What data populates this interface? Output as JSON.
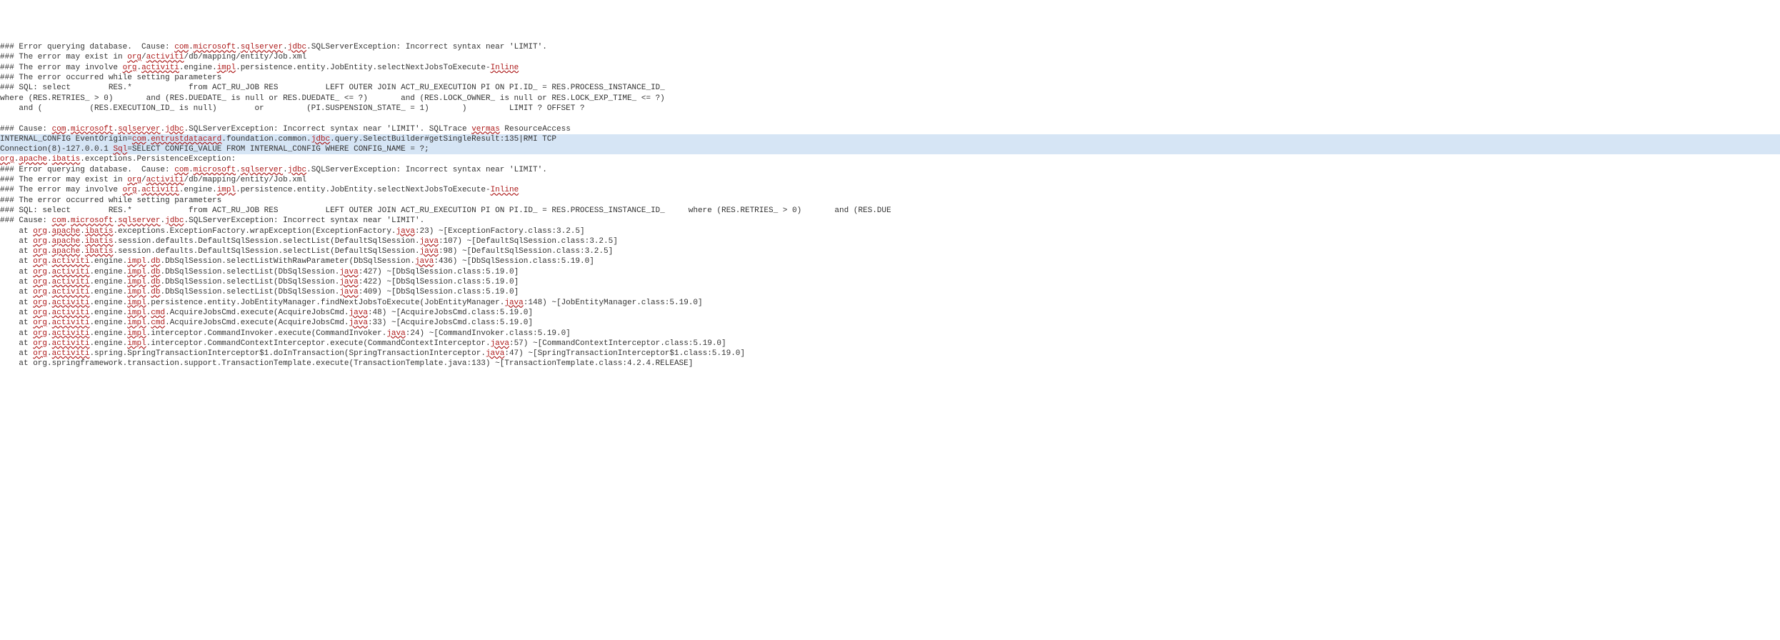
{
  "log": {
    "lines": [
      {
        "cls": "",
        "parts": [
          {
            "t": "### Error querying database.  Cause: "
          },
          {
            "t": "com",
            "e": 1
          },
          {
            "t": "."
          },
          {
            "t": "microsoft",
            "e": 1
          },
          {
            "t": "."
          },
          {
            "t": "sqlserver",
            "e": 1
          },
          {
            "t": "."
          },
          {
            "t": "jdbc",
            "e": 1
          },
          {
            "t": ".SQLServerException: Incorrect syntax near 'LIMIT'."
          }
        ]
      },
      {
        "cls": "",
        "parts": [
          {
            "t": "### The error may exist in "
          },
          {
            "t": "org",
            "e": 1
          },
          {
            "t": "/"
          },
          {
            "t": "activiti",
            "e": 1
          },
          {
            "t": "/db/mapping/entity/Job.xml"
          }
        ]
      },
      {
        "cls": "",
        "parts": [
          {
            "t": "### The error may involve "
          },
          {
            "t": "org",
            "e": 1
          },
          {
            "t": "."
          },
          {
            "t": "activiti",
            "e": 1
          },
          {
            "t": ".engine."
          },
          {
            "t": "impl",
            "e": 1
          },
          {
            "t": ".persistence.entity.JobEntity.selectNextJobsToExecute-"
          },
          {
            "t": "Inline",
            "e": 1
          }
        ]
      },
      {
        "cls": "",
        "parts": [
          {
            "t": "### The error occurred while setting parameters"
          }
        ]
      },
      {
        "cls": "",
        "parts": [
          {
            "t": "### SQL: select        RES.*            from ACT_RU_JOB RES          LEFT OUTER JOIN ACT_RU_EXECUTION PI ON PI.ID_ = RES.PROCESS_INSTANCE_ID_"
          }
        ]
      },
      {
        "cls": "",
        "parts": [
          {
            "t": "where (RES.RETRIES_ > 0)       and (RES.DUEDATE_ is null or RES.DUEDATE_ <= ?)       and (RES.LOCK_OWNER_ is null or RES.LOCK_EXP_TIME_ <= ?)"
          }
        ]
      },
      {
        "cls": "",
        "parts": [
          {
            "t": "    and (          (RES.EXECUTION_ID_ is null)        or         (PI.SUSPENSION_STATE_ = 1)       )         LIMIT ? OFFSET ?"
          }
        ]
      },
      {
        "cls": "",
        "parts": [
          {
            "t": ""
          }
        ]
      },
      {
        "cls": "",
        "parts": [
          {
            "t": "### Cause: "
          },
          {
            "t": "com",
            "e": 1
          },
          {
            "t": "."
          },
          {
            "t": "microsoft",
            "e": 1
          },
          {
            "t": "."
          },
          {
            "t": "sqlserver",
            "e": 1
          },
          {
            "t": "."
          },
          {
            "t": "jdbc",
            "e": 1
          },
          {
            "t": ".SQLServerException: Incorrect syntax near 'LIMIT'. SQLTrace "
          },
          {
            "t": "vermas",
            "e": 1
          },
          {
            "t": " ResourceAccess"
          }
        ]
      },
      {
        "cls": "highlighted",
        "parts": [
          {
            "t": "INTERNAL_CONFIG EventOrigin="
          },
          {
            "t": "com",
            "e": 1
          },
          {
            "t": "."
          },
          {
            "t": "entrustdatacard",
            "e": 1
          },
          {
            "t": ".foundation.common."
          },
          {
            "t": "jdbc",
            "e": 1
          },
          {
            "t": ".query.SelectBuilder#getSingleResult:135|RMI TCP"
          }
        ]
      },
      {
        "cls": "highlighted",
        "parts": [
          {
            "t": "Connection(8)-127.0.0.1 "
          },
          {
            "t": "Sql",
            "e": 1
          },
          {
            "t": "=SELECT CONFIG_VALUE FROM INTERNAL_CONFIG WHERE CONFIG_NAME = ?;"
          }
        ]
      },
      {
        "cls": "",
        "parts": [
          {
            "t": "org",
            "e": 1
          },
          {
            "t": "."
          },
          {
            "t": "apache",
            "e": 1
          },
          {
            "t": "."
          },
          {
            "t": "ibatis",
            "e": 1
          },
          {
            "t": ".exceptions.PersistenceException:"
          }
        ]
      },
      {
        "cls": "",
        "parts": [
          {
            "t": "### Error querying database.  Cause: "
          },
          {
            "t": "com",
            "e": 1
          },
          {
            "t": "."
          },
          {
            "t": "microsoft",
            "e": 1
          },
          {
            "t": "."
          },
          {
            "t": "sqlserver",
            "e": 1
          },
          {
            "t": "."
          },
          {
            "t": "jdbc",
            "e": 1
          },
          {
            "t": ".SQLServerException: Incorrect syntax near 'LIMIT'."
          }
        ]
      },
      {
        "cls": "",
        "parts": [
          {
            "t": "### The error may exist in "
          },
          {
            "t": "org",
            "e": 1
          },
          {
            "t": "/"
          },
          {
            "t": "activiti",
            "e": 1
          },
          {
            "t": "/db/mapping/entity/Job.xml"
          }
        ]
      },
      {
        "cls": "",
        "parts": [
          {
            "t": "### The error may involve "
          },
          {
            "t": "org",
            "e": 1
          },
          {
            "t": "."
          },
          {
            "t": "activiti",
            "e": 1
          },
          {
            "t": ".engine."
          },
          {
            "t": "impl",
            "e": 1
          },
          {
            "t": ".persistence.entity.JobEntity.selectNextJobsToExecute-"
          },
          {
            "t": "Inline",
            "e": 1
          }
        ]
      },
      {
        "cls": "",
        "parts": [
          {
            "t": "### The error occurred while setting parameters"
          }
        ]
      },
      {
        "cls": "",
        "parts": [
          {
            "t": "### SQL: select        RES.*            from ACT_RU_JOB RES          LEFT OUTER JOIN ACT_RU_EXECUTION PI ON PI.ID_ = RES.PROCESS_INSTANCE_ID_     where (RES.RETRIES_ > 0)       and (RES.DUE"
          }
        ]
      },
      {
        "cls": "",
        "parts": [
          {
            "t": "### Cause: "
          },
          {
            "t": "com",
            "e": 1
          },
          {
            "t": "."
          },
          {
            "t": "microsoft",
            "e": 1
          },
          {
            "t": "."
          },
          {
            "t": "sqlserver",
            "e": 1
          },
          {
            "t": "."
          },
          {
            "t": "jdbc",
            "e": 1
          },
          {
            "t": ".SQLServerException: Incorrect syntax near 'LIMIT'."
          }
        ]
      },
      {
        "cls": "",
        "parts": [
          {
            "t": "    at "
          },
          {
            "t": "org",
            "e": 1
          },
          {
            "t": "."
          },
          {
            "t": "apache",
            "e": 1
          },
          {
            "t": "."
          },
          {
            "t": "ibatis",
            "e": 1
          },
          {
            "t": ".exceptions.ExceptionFactory.wrapException(ExceptionFactory."
          },
          {
            "t": "java",
            "e": 1
          },
          {
            "t": ":23) ~[ExceptionFactory.class:3.2.5]"
          }
        ]
      },
      {
        "cls": "",
        "parts": [
          {
            "t": "    at "
          },
          {
            "t": "org",
            "e": 1
          },
          {
            "t": "."
          },
          {
            "t": "apache",
            "e": 1
          },
          {
            "t": "."
          },
          {
            "t": "ibatis",
            "e": 1
          },
          {
            "t": ".session.defaults.DefaultSqlSession.selectList(DefaultSqlSession."
          },
          {
            "t": "java",
            "e": 1
          },
          {
            "t": ":107) ~[DefaultSqlSession.class:3.2.5]"
          }
        ]
      },
      {
        "cls": "",
        "parts": [
          {
            "t": "    at "
          },
          {
            "t": "org",
            "e": 1
          },
          {
            "t": "."
          },
          {
            "t": "apache",
            "e": 1
          },
          {
            "t": "."
          },
          {
            "t": "ibatis",
            "e": 1
          },
          {
            "t": ".session.defaults.DefaultSqlSession.selectList(DefaultSqlSession."
          },
          {
            "t": "java",
            "e": 1
          },
          {
            "t": ":98) ~[DefaultSqlSession.class:3.2.5]"
          }
        ]
      },
      {
        "cls": "",
        "parts": [
          {
            "t": "    at "
          },
          {
            "t": "org",
            "e": 1
          },
          {
            "t": "."
          },
          {
            "t": "activiti",
            "e": 1
          },
          {
            "t": ".engine."
          },
          {
            "t": "impl",
            "e": 1
          },
          {
            "t": "."
          },
          {
            "t": "db",
            "e": 1
          },
          {
            "t": ".DbSqlSession.selectListWithRawParameter(DbSqlSession."
          },
          {
            "t": "java",
            "e": 1
          },
          {
            "t": ":436) ~[DbSqlSession.class:5.19.0]"
          }
        ]
      },
      {
        "cls": "",
        "parts": [
          {
            "t": "    at "
          },
          {
            "t": "org",
            "e": 1
          },
          {
            "t": "."
          },
          {
            "t": "activiti",
            "e": 1
          },
          {
            "t": ".engine."
          },
          {
            "t": "impl",
            "e": 1
          },
          {
            "t": "."
          },
          {
            "t": "db",
            "e": 1
          },
          {
            "t": ".DbSqlSession.selectList(DbSqlSession."
          },
          {
            "t": "java",
            "e": 1
          },
          {
            "t": ":427) ~[DbSqlSession.class:5.19.0]"
          }
        ]
      },
      {
        "cls": "",
        "parts": [
          {
            "t": "    at "
          },
          {
            "t": "org",
            "e": 1
          },
          {
            "t": "."
          },
          {
            "t": "activiti",
            "e": 1
          },
          {
            "t": ".engine."
          },
          {
            "t": "impl",
            "e": 1
          },
          {
            "t": "."
          },
          {
            "t": "db",
            "e": 1
          },
          {
            "t": ".DbSqlSession.selectList(DbSqlSession."
          },
          {
            "t": "java",
            "e": 1
          },
          {
            "t": ":422) ~[DbSqlSession.class:5.19.0]"
          }
        ]
      },
      {
        "cls": "",
        "parts": [
          {
            "t": "    at "
          },
          {
            "t": "org",
            "e": 1
          },
          {
            "t": "."
          },
          {
            "t": "activiti",
            "e": 1
          },
          {
            "t": ".engine."
          },
          {
            "t": "impl",
            "e": 1
          },
          {
            "t": "."
          },
          {
            "t": "db",
            "e": 1
          },
          {
            "t": ".DbSqlSession.selectList(DbSqlSession."
          },
          {
            "t": "java",
            "e": 1
          },
          {
            "t": ":409) ~[DbSqlSession.class:5.19.0]"
          }
        ]
      },
      {
        "cls": "",
        "parts": [
          {
            "t": "    at "
          },
          {
            "t": "org",
            "e": 1
          },
          {
            "t": "."
          },
          {
            "t": "activiti",
            "e": 1
          },
          {
            "t": ".engine."
          },
          {
            "t": "impl",
            "e": 1
          },
          {
            "t": ".persistence.entity.JobEntityManager.findNextJobsToExecute(JobEntityManager."
          },
          {
            "t": "java",
            "e": 1
          },
          {
            "t": ":148) ~[JobEntityManager.class:5.19.0]"
          }
        ]
      },
      {
        "cls": "",
        "parts": [
          {
            "t": "    at "
          },
          {
            "t": "org",
            "e": 1
          },
          {
            "t": "."
          },
          {
            "t": "activiti",
            "e": 1
          },
          {
            "t": ".engine."
          },
          {
            "t": "impl",
            "e": 1
          },
          {
            "t": "."
          },
          {
            "t": "cmd",
            "e": 1
          },
          {
            "t": ".AcquireJobsCmd.execute(AcquireJobsCmd."
          },
          {
            "t": "java",
            "e": 1
          },
          {
            "t": ":48) ~[AcquireJobsCmd.class:5.19.0]"
          }
        ]
      },
      {
        "cls": "",
        "parts": [
          {
            "t": "    at "
          },
          {
            "t": "org",
            "e": 1
          },
          {
            "t": "."
          },
          {
            "t": "activiti",
            "e": 1
          },
          {
            "t": ".engine."
          },
          {
            "t": "impl",
            "e": 1
          },
          {
            "t": "."
          },
          {
            "t": "cmd",
            "e": 1
          },
          {
            "t": ".AcquireJobsCmd.execute(AcquireJobsCmd."
          },
          {
            "t": "java",
            "e": 1
          },
          {
            "t": ":33) ~[AcquireJobsCmd.class:5.19.0]"
          }
        ]
      },
      {
        "cls": "",
        "parts": [
          {
            "t": "    at "
          },
          {
            "t": "org",
            "e": 1
          },
          {
            "t": "."
          },
          {
            "t": "activiti",
            "e": 1
          },
          {
            "t": ".engine."
          },
          {
            "t": "impl",
            "e": 1
          },
          {
            "t": ".interceptor.CommandInvoker.execute(CommandInvoker."
          },
          {
            "t": "java",
            "e": 1
          },
          {
            "t": ":24) ~[CommandInvoker.class:5.19.0]"
          }
        ]
      },
      {
        "cls": "",
        "parts": [
          {
            "t": "    at "
          },
          {
            "t": "org",
            "e": 1
          },
          {
            "t": "."
          },
          {
            "t": "activiti",
            "e": 1
          },
          {
            "t": ".engine."
          },
          {
            "t": "impl",
            "e": 1
          },
          {
            "t": ".interceptor.CommandContextInterceptor.execute(CommandContextInterceptor."
          },
          {
            "t": "java",
            "e": 1
          },
          {
            "t": ":57) ~[CommandContextInterceptor.class:5.19.0]"
          }
        ]
      },
      {
        "cls": "",
        "parts": [
          {
            "t": "    at "
          },
          {
            "t": "org",
            "e": 1
          },
          {
            "t": "."
          },
          {
            "t": "activiti",
            "e": 1
          },
          {
            "t": ".spring.SpringTransactionInterceptor$1.doInTransaction(SpringTransactionInterceptor."
          },
          {
            "t": "java",
            "e": 1
          },
          {
            "t": ":47) ~[SpringTransactionInterceptor$1.class:5.19.0]"
          }
        ]
      },
      {
        "cls": "",
        "parts": [
          {
            "t": "    at org.springframework.transaction.support.TransactionTemplate.execute(TransactionTemplate.java:133) ~[TransactionTemplate.class:4.2.4.RELEASE]"
          }
        ]
      }
    ]
  }
}
